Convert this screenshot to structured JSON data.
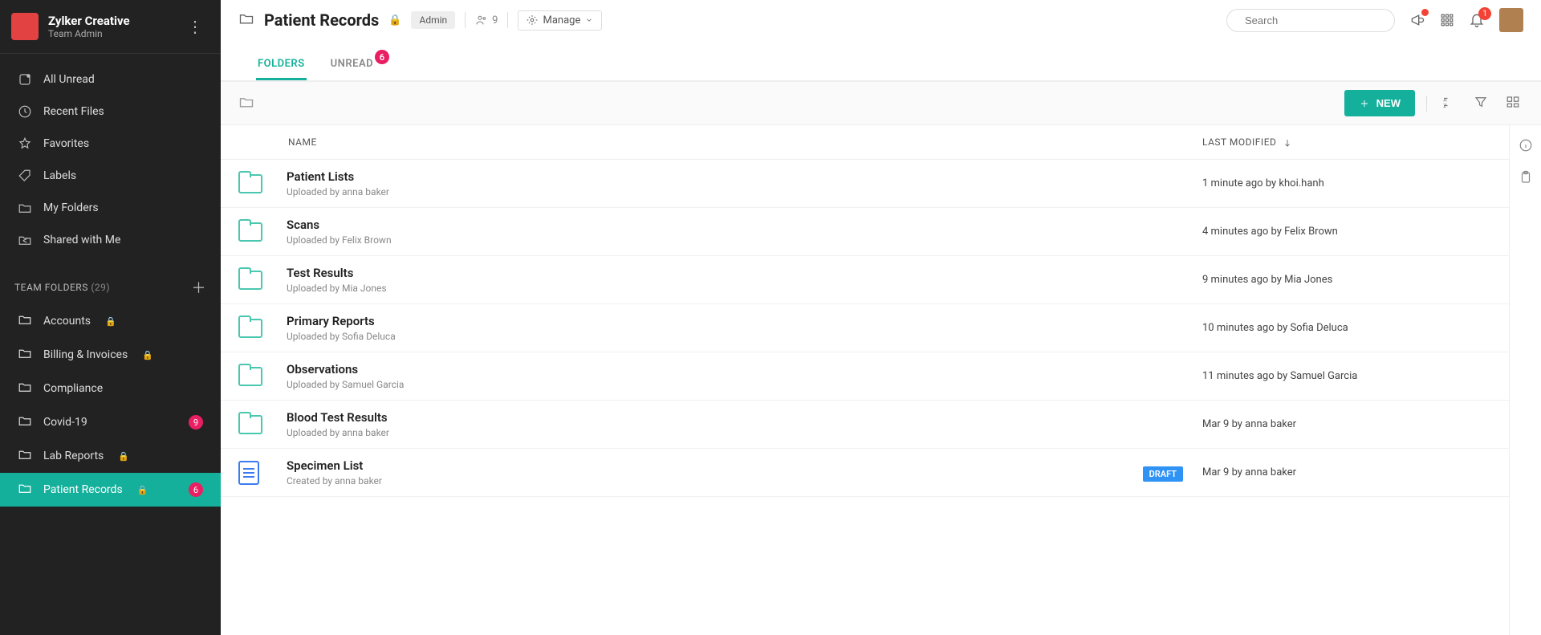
{
  "org": {
    "name": "Zylker Creative",
    "role": "Team Admin"
  },
  "nav": {
    "primary": [
      {
        "label": "All Unread"
      },
      {
        "label": "Recent Files"
      },
      {
        "label": "Favorites"
      },
      {
        "label": "Labels"
      },
      {
        "label": "My Folders"
      },
      {
        "label": "Shared with Me"
      }
    ],
    "section_label": "TEAM FOLDERS",
    "section_count": "(29)",
    "team": [
      {
        "label": "Accounts",
        "locked": true
      },
      {
        "label": "Billing & Invoices",
        "locked": true
      },
      {
        "label": "Compliance"
      },
      {
        "label": "Covid-19",
        "badge": "9"
      },
      {
        "label": "Lab Reports",
        "locked": true
      },
      {
        "label": "Patient Records",
        "locked": true,
        "badge": "6",
        "active": true
      }
    ]
  },
  "header": {
    "title": "Patient Records",
    "role_badge": "Admin",
    "member_count": "9",
    "manage_label": "Manage",
    "search_placeholder": "Search",
    "notif_count": "1"
  },
  "tabs": [
    {
      "label": "FOLDERS",
      "active": true
    },
    {
      "label": "UNREAD",
      "badge": "6"
    }
  ],
  "toolbar": {
    "new_label": "NEW"
  },
  "columns": {
    "name": "NAME",
    "modified": "LAST MODIFIED"
  },
  "rows": [
    {
      "type": "folder",
      "name": "Patient Lists",
      "sub": "Uploaded by anna baker",
      "modified": "1 minute ago by khoi.hanh"
    },
    {
      "type": "folder",
      "name": "Scans",
      "sub": "Uploaded by Felix Brown",
      "modified": "4 minutes ago by Felix Brown"
    },
    {
      "type": "folder",
      "name": "Test Results",
      "sub": "Uploaded by Mia Jones",
      "modified": "9 minutes ago by Mia Jones"
    },
    {
      "type": "folder",
      "name": "Primary Reports",
      "sub": "Uploaded by Sofia Deluca",
      "modified": "10 minutes ago by Sofia Deluca"
    },
    {
      "type": "folder",
      "name": "Observations",
      "sub": "Uploaded by Samuel Garcia",
      "modified": "11 minutes ago by Samuel Garcia"
    },
    {
      "type": "folder",
      "name": "Blood Test Results",
      "sub": "Uploaded by anna baker",
      "modified": "Mar 9 by anna baker"
    },
    {
      "type": "doc",
      "name": "Specimen List",
      "sub": "Created by anna baker",
      "tag": "DRAFT",
      "modified": "Mar 9 by anna baker"
    }
  ]
}
